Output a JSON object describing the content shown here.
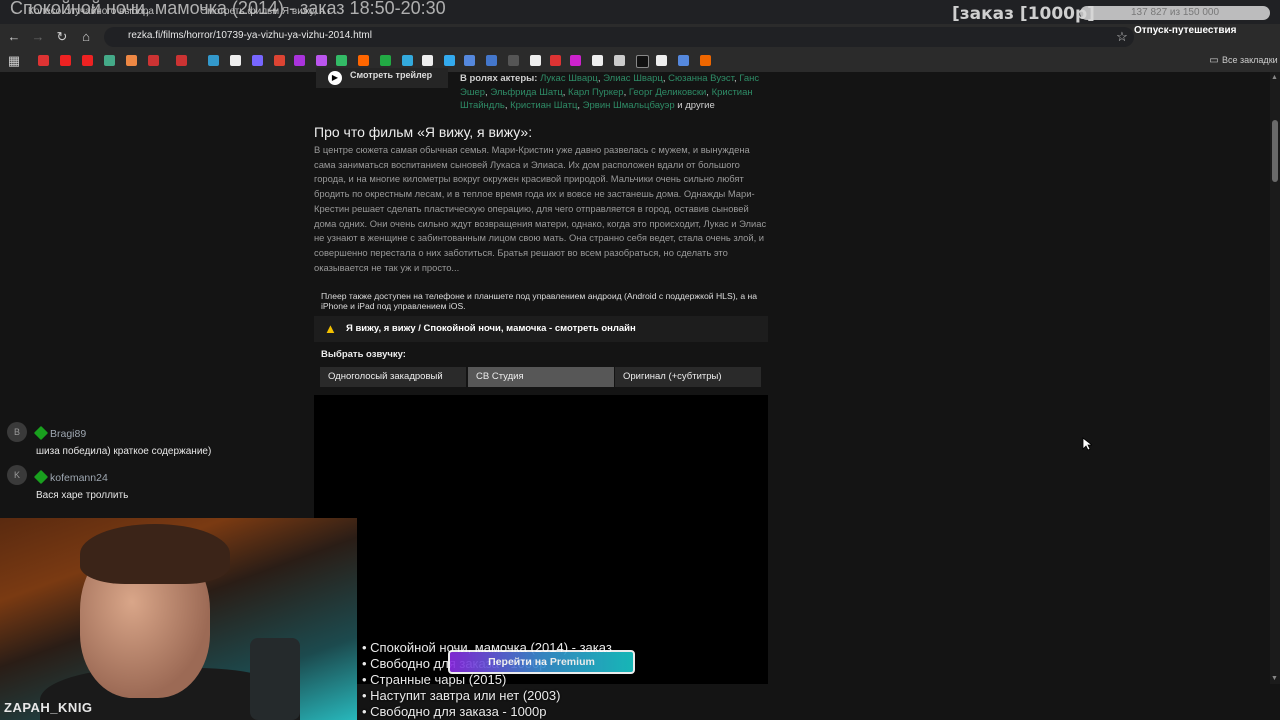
{
  "browser": {
    "tabs": [
      {
        "label": "Колесо случайного выбора"
      },
      {
        "label": "Смотреть фильм Я вижу, я вижу"
      }
    ],
    "url": "rezka.fi/films/horror/10739-ya-vizhu-ya-vizhu-2014.html",
    "bookmarks_all": "Все закладки"
  },
  "overlay": {
    "stream_title": "Спокойной ночи, мамочка (2014) - заказ 18:50-20:30",
    "order_badge": "[заказ [1000р]",
    "progress_text": "137 827 из 150 000",
    "progress_fraction": 0.919,
    "vacation": "Отпуск-путешествия",
    "streamer_name": "ZAPAH_KNIG",
    "premium_button": "Перейти на Premium"
  },
  "movie": {
    "trailer_button": "Смотреть трейлер",
    "actors_label": "В ролях актеры:",
    "actors": [
      "Лукас Шварц",
      "Элиас Шварц",
      "Сюзанна Вуэст",
      "Ганс Эшер",
      "Эльфрида Шатц",
      "Карл Пуркер",
      "Георг Деликовски",
      "Кристиан Штайндль",
      "Кристиан Шатц",
      "Эрвин Шмальцбауэр"
    ],
    "actors_suffix": "и другие",
    "about_heading": "Про что фильм «Я вижу, я вижу»:",
    "about_text": "В центре сюжета самая обычная семья. Мари-Кристин уже давно развелась с мужем, и вынуждена сама заниматься воспитанием сыновей Лукаса и Элиаса. Их дом расположен вдали от большого города, и на многие километры вокруг окружен красивой природой. Мальчики очень сильно любят бродить по окрестным лесам, и в теплое время года их и вовсе не застанешь дома. Однажды Мари-Крестин решает сделать пластическую операцию, для чего отправляется в город, оставив сыновей дома одних. Они очень сильно ждут возвращения матери, однако, когда это происходит, Лукас и Элиас не узнают в женщине с забинтованным лицом свою мать. Она странно себя ведет, стала очень злой, и совершенно перестала о них заботиться. Братья решают во всем разобраться, но сделать это оказывается не так уж и просто...",
    "player_note": "Плеер также доступен на телефоне и планшете под управлением андроид (Android с поддержкой HLS), а на iPhone и iPad под управлением iOS.",
    "watch_title": "Я вижу, я вижу / Спокойной ночи, мамочка - смотреть онлайн",
    "voice_label": "Выбрать озвучку:",
    "voices": [
      {
        "label": "Одноголосый закадровый"
      },
      {
        "label": "СВ Студия"
      },
      {
        "label": "Оригинал (+субтитры)"
      }
    ]
  },
  "chat": [
    {
      "avatar": "B",
      "user": "Bragi89",
      "message": "шиза победила) краткое содержание)"
    },
    {
      "avatar": "K",
      "user": "kofemann24",
      "message": "Вася харе троллить"
    }
  ],
  "order_list": [
    "• Спокойной ночи, мамочка (2014) - заказ",
    "• Свободно для заказа - 1000р",
    "• Странные чары (2015)",
    "• Наступит завтра или нет (2003)",
    "• Свободно для заказа - 1000р"
  ]
}
